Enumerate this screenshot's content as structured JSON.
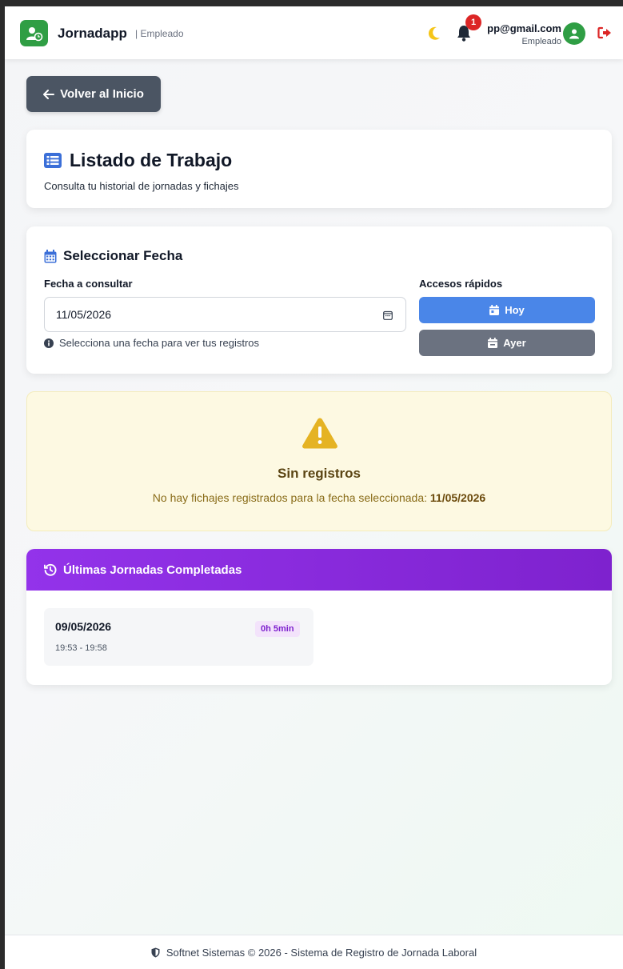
{
  "header": {
    "brand": "Jornadapp",
    "role_tag": "| Empleado",
    "notification_count": "1",
    "user_email": "pp@gmail.com",
    "user_role": "Empleado"
  },
  "nav": {
    "back_label": "Volver al Inicio"
  },
  "title_card": {
    "title": "Listado de Trabajo",
    "subtitle": "Consulta tu historial de jornadas y fichajes"
  },
  "date_card": {
    "title": "Seleccionar Fecha",
    "date_label": "Fecha a consultar",
    "date_value": "11/05/2026",
    "hint": "Selecciona una fecha para ver tus registros",
    "quick_label": "Accesos rápidos",
    "today_label": "Hoy",
    "yesterday_label": "Ayer"
  },
  "empty_state": {
    "title": "Sin registros",
    "message": "No hay fichajes registrados para la fecha seleccionada: ",
    "date": "11/05/2026"
  },
  "recent": {
    "title": "Últimas Jornadas Completadas",
    "items": [
      {
        "date": "09/05/2026",
        "duration": "0h 5min",
        "time_range": "19:53 - 19:58"
      }
    ]
  },
  "footer": {
    "text": "Softnet Sistemas © 2026 - Sistema de Registro de Jornada Laboral"
  },
  "colors": {
    "brand_green": "#2f9e44",
    "primary_blue": "#4a86e8",
    "secondary_gray": "#6b7280",
    "warning_bg": "#fdf9e2",
    "purple_header": "#9333ea",
    "danger_red": "#dc2626"
  },
  "icons": [
    "user-clock-icon",
    "moon-icon",
    "bell-icon",
    "user-icon",
    "logout-icon",
    "arrow-left-icon",
    "list-icon",
    "calendar-icon",
    "info-icon",
    "calendar-day-icon",
    "warning-icon",
    "history-icon",
    "shield-icon"
  ]
}
